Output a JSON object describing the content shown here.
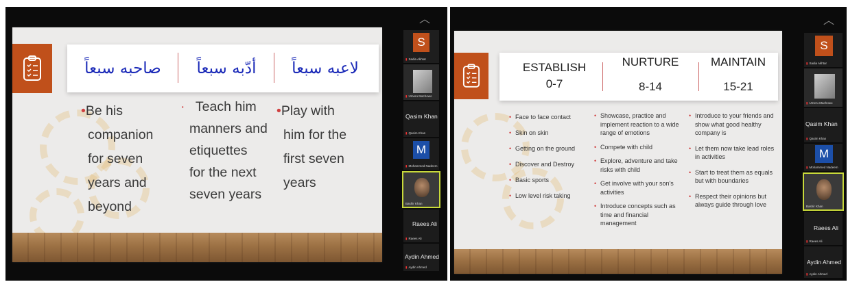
{
  "left": {
    "slide": {
      "arabic": [
        "لاعبه سبعاً",
        "أدّبه سبعاً",
        "صاحبه سبعاً"
      ],
      "col1": {
        "bullet": "•",
        "lines": [
          "Be his",
          "companion",
          "for seven",
          "years and",
          "beyond"
        ]
      },
      "col2": {
        "bullet": "·",
        "lines": [
          "Teach him",
          "manners and",
          "etiquettes",
          "for the next",
          "seven years"
        ]
      },
      "col3": {
        "bullet": "•",
        "lines": [
          "Play with",
          "him for the",
          "first seven",
          "years"
        ]
      }
    },
    "participants": {
      "t1": {
        "initial": "S",
        "caption": "Sadia Akhtar",
        "color": "#c0501b"
      },
      "t2": {
        "caption": "Umeru Machowo"
      },
      "t3": {
        "name": "Qasim Khan",
        "caption": "Qasim Khan"
      },
      "t4": {
        "initial": "M",
        "caption": "Mohammed Nadeem",
        "color": "#1c4fa8"
      },
      "t5": {
        "caption": "Bashir Khan"
      },
      "t6": {
        "name": "Raees Ali",
        "caption": "Raees Ali"
      },
      "t7": {
        "name": "Aydin Ahmed",
        "caption": "Aydin Ahmed"
      }
    }
  },
  "right": {
    "slide": {
      "headers": [
        {
          "title": "ESTABLISH",
          "range": "0-7"
        },
        {
          "title": "NURTURE",
          "range": "8-14"
        },
        {
          "title": "MAINTAIN",
          "range": "15-21"
        }
      ],
      "col1": [
        "Face to face contact",
        "Skin on skin",
        "Getting on the ground",
        "Discover and Destroy",
        "Basic sports",
        "Low level risk taking"
      ],
      "col2": [
        "Showcase, practice and implement reaction to a wide range of emotions",
        "Compete with child",
        "Explore, adventure and take risks with child",
        "Get involve with your son's activities",
        "Introduce concepts such as time and financial management"
      ],
      "col3": [
        "Introduce to your friends and show what good healthy company is",
        "Let them now take lead roles in activities",
        "Start to treat them as equals but with boundaries",
        "Respect their opinions but always guide through love"
      ]
    },
    "participants": {
      "t1": {
        "initial": "S",
        "caption": "Sadia Akhtar",
        "color": "#c0501b"
      },
      "t2": {
        "caption": "Umeru Machowo"
      },
      "t3": {
        "name": "Qasim Khan",
        "caption": "Qasim Khan"
      },
      "t4": {
        "initial": "M",
        "caption": "Mohammed Nadeem",
        "color": "#1c4fa8"
      },
      "t5": {
        "caption": "Bashir Khan"
      },
      "t6": {
        "name": "Raees Ali",
        "caption": "Raees Ali"
      },
      "t7": {
        "name": "Aydin Ahmed",
        "caption": "Aydin Ahmed"
      }
    }
  },
  "icons": {
    "scroll_up": "chevron-up-icon",
    "slide_icon": "clipboard-checklist-icon",
    "mic": "mic-muted-icon"
  }
}
